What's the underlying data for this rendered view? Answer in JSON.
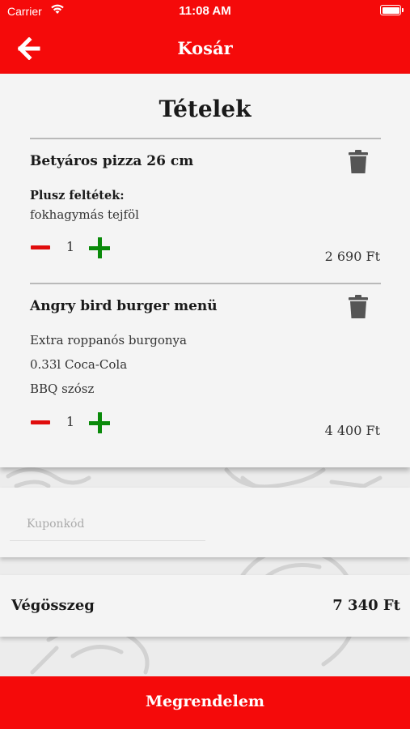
{
  "status_bar": {
    "carrier": "Carrier",
    "time": "11:08 AM"
  },
  "header": {
    "title": "Kosár",
    "back_icon": "arrow-left-icon"
  },
  "cart": {
    "heading": "Tételek",
    "items": [
      {
        "name": "Betyáros pizza 26 cm",
        "extras_label": "Plusz feltétek:",
        "extras": [
          "fokhagymás tejföl"
        ],
        "quantity": "1",
        "price": "2 690 Ft"
      },
      {
        "name": "Angry bird burger menü",
        "extras_label": "",
        "extras": [
          "Extra roppanós burgonya",
          "0.33l Coca-Cola",
          "BBQ szósz"
        ],
        "quantity": "1",
        "price": "4 400 Ft"
      }
    ]
  },
  "coupon": {
    "placeholder": "Kuponkód",
    "value": ""
  },
  "total": {
    "label": "Végösszeg",
    "value": "7 340 Ft"
  },
  "order_button": {
    "label": "Megrendelem"
  },
  "colors": {
    "brand_red": "#f50a0a",
    "minus_red": "#e00d0d",
    "plus_green": "#0a8a0a",
    "trash_gray": "#555555"
  }
}
